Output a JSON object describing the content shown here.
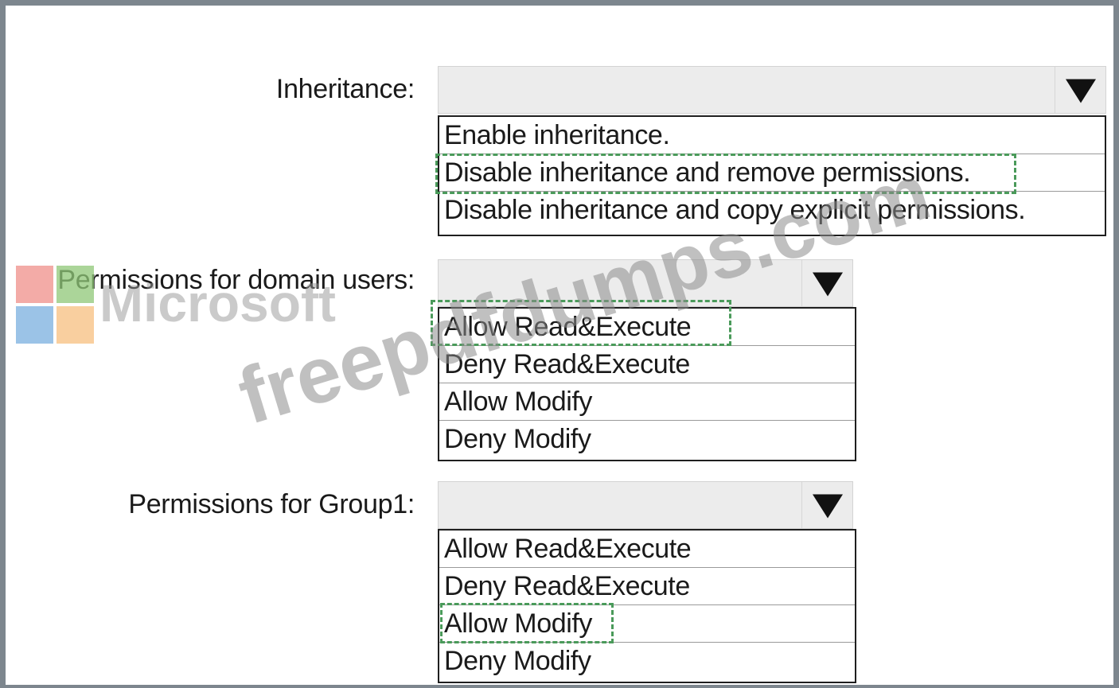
{
  "sections": [
    {
      "label": "Inheritance:",
      "options": [
        "Enable inheritance.",
        "Disable inheritance and remove permissions.",
        "Disable inheritance and copy explicit permissions."
      ],
      "highlighted": "Disable inheritance and remove permissions."
    },
    {
      "label": "Permissions for domain users:",
      "options": [
        "Allow Read&Execute",
        "Deny Read&Execute",
        "Allow Modify",
        "Deny Modify"
      ],
      "highlighted": "Allow Read&Execute"
    },
    {
      "label": "Permissions for Group1:",
      "options": [
        "Allow Read&Execute",
        "Deny Read&Execute",
        "Allow Modify",
        "Deny Modify"
      ],
      "highlighted": "Allow Modify"
    }
  ],
  "watermark": {
    "brand": "Microsoft",
    "site": "freepdfdumps.com",
    "logo_colors": [
      "#f0908a",
      "#90c878",
      "#7ab0e0",
      "#f8c080"
    ]
  },
  "highlight_color": "#4a9a5a"
}
